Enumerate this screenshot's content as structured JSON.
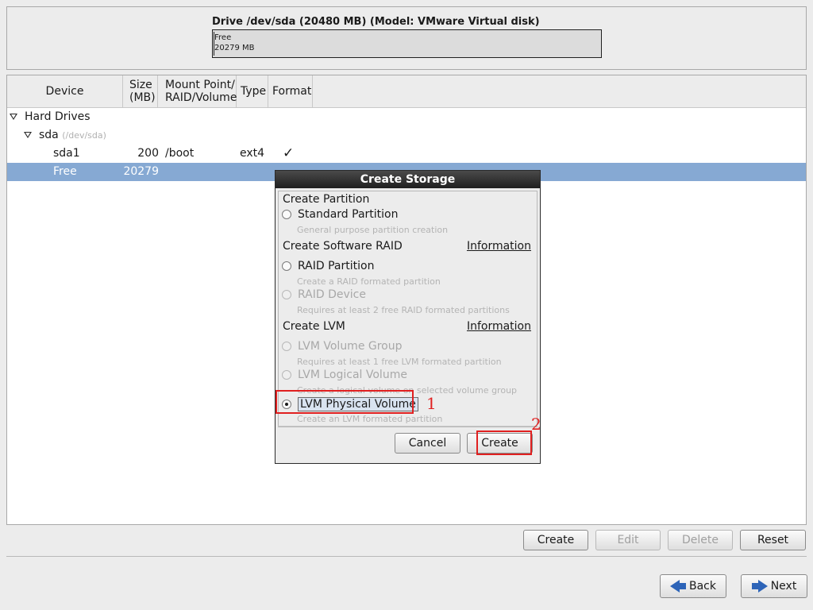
{
  "drive": {
    "title": "Drive /dev/sda (20480 MB) (Model: VMware Virtual disk)",
    "bar_label": "Free",
    "bar_size": "20279 MB"
  },
  "tree": {
    "headers": {
      "device": "Device",
      "size": "Size\n(MB)",
      "mount": "Mount Point/\nRAID/Volume",
      "type": "Type",
      "format": "Format"
    },
    "hard_drives_label": "Hard Drives",
    "sda": {
      "name": "sda",
      "path": "(/dev/sda)"
    },
    "rows": [
      {
        "device": "sda1",
        "size": "200",
        "mount": "/boot",
        "type": "ext4",
        "format": "✓"
      },
      {
        "device": "Free",
        "size": "20279",
        "mount": "",
        "type": "",
        "format": ""
      }
    ]
  },
  "dialog": {
    "title": "Create Storage",
    "section_partition": "Create Partition",
    "standard_partition": "Standard Partition",
    "standard_partition_hint": "General purpose partition creation",
    "section_raid": "Create Software RAID",
    "information_1": "Information",
    "raid_partition": "RAID Partition",
    "raid_partition_hint": "Create a RAID formated partition",
    "raid_device": "RAID Device",
    "raid_device_hint": "Requires at least 2 free RAID formated partitions",
    "section_lvm": "Create LVM",
    "information_2": "Information",
    "lvm_volume_group": "LVM Volume Group",
    "lvm_volume_group_hint": "Requires at least 1 free LVM formated partition",
    "lvm_logical_volume": "LVM Logical Volume",
    "lvm_logical_volume_hint": "Create a logical volume on selected volume group",
    "lvm_physical_volume": "LVM Physical Volume",
    "lvm_physical_volume_hint": "Create an LVM formated partition",
    "cancel": "Cancel",
    "create": "Create",
    "annotation_1": "1",
    "annotation_2": "2"
  },
  "buttons": {
    "create": "Create",
    "edit": "Edit",
    "delete": "Delete",
    "reset": "Reset",
    "back": "Back",
    "next": "Next"
  },
  "colors": {
    "selection": "#86a9d3",
    "annotation": "#e02020",
    "nav_arrow": "#2d64b8"
  }
}
